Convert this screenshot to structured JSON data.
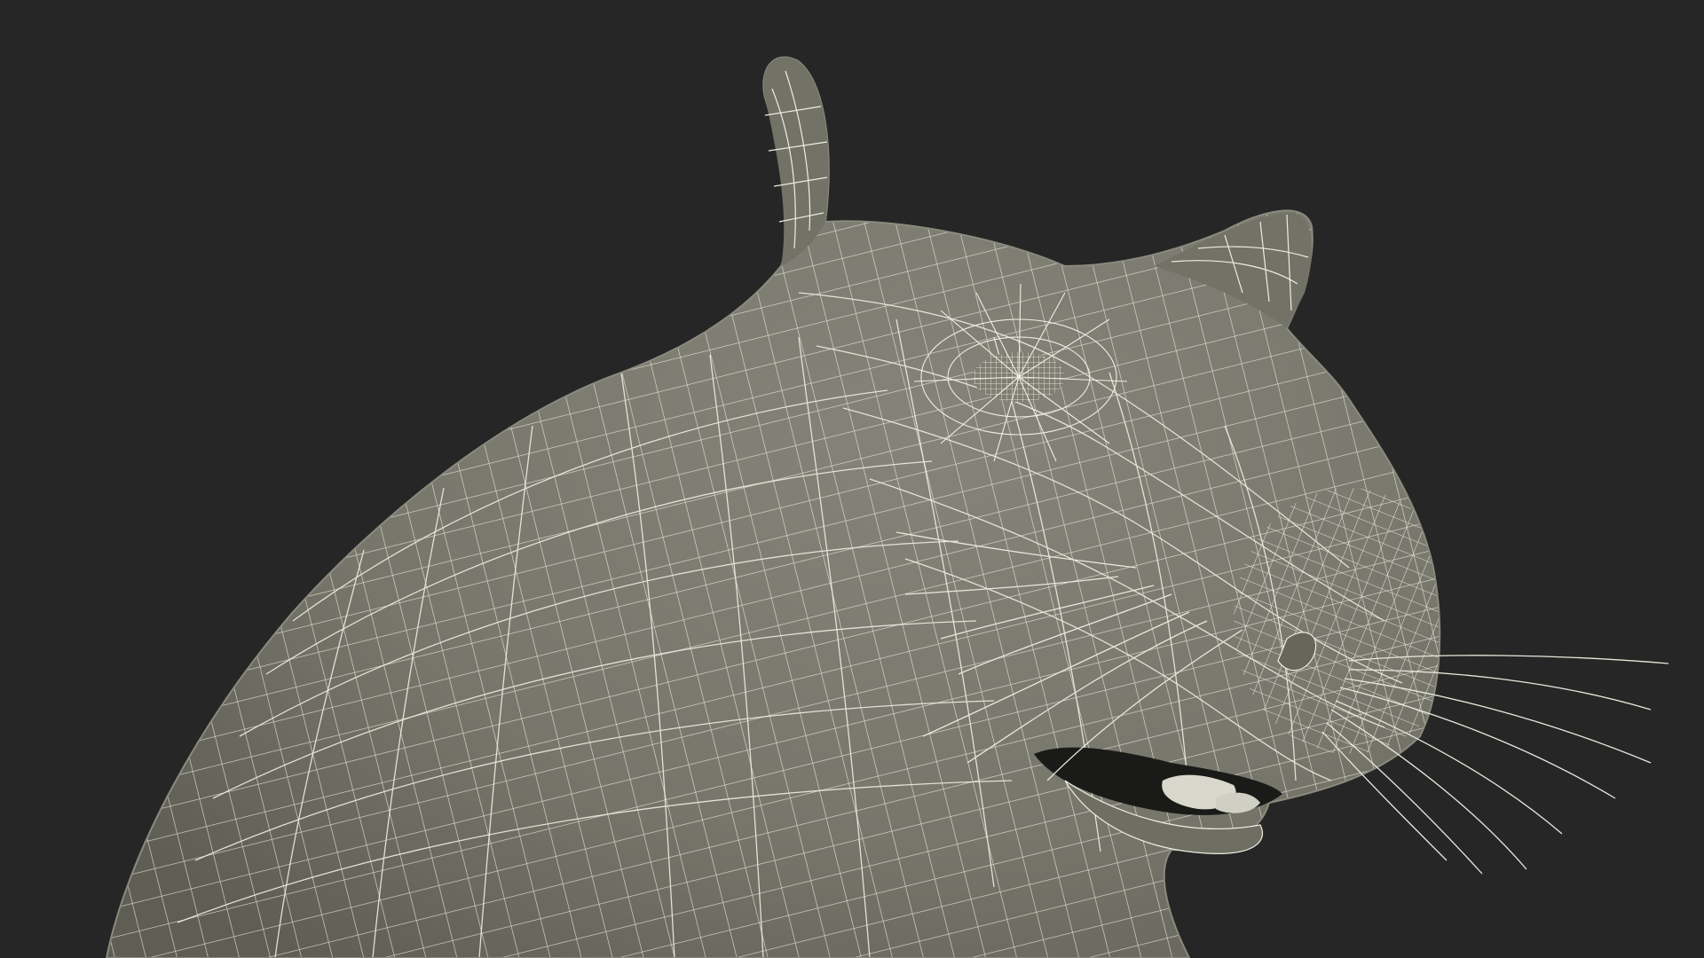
{
  "scene": {
    "subject": "wireframe-rodent-head",
    "background_color": "#262626",
    "surface_color": "#7a7a6e",
    "surface_shadow_color": "#5f5f55",
    "wire_color": "#eeeee2",
    "mouth_color": "#1a1a18",
    "tooth_color": "#d8d8cc"
  }
}
